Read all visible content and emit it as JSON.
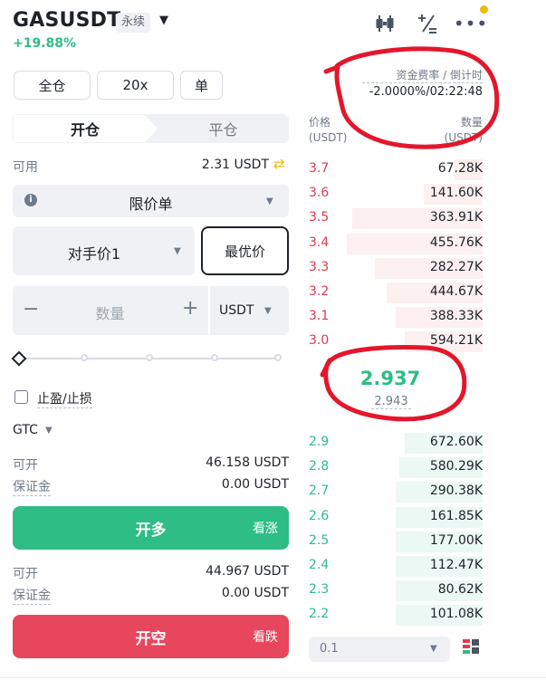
{
  "header": {
    "symbol": "GASUSDT",
    "contract_type": "永续",
    "change": "+19.88%",
    "icons": [
      "candlestick-chart-icon",
      "calculator-icon",
      "more-icon"
    ]
  },
  "controls": {
    "margin_mode": "全仓",
    "leverage": "20x",
    "position_mode": "单"
  },
  "tabs": {
    "open": "开仓",
    "close": "平仓"
  },
  "available": {
    "label": "可用",
    "value": "2.31 USDT"
  },
  "order_type": {
    "value": "限价单"
  },
  "price": {
    "value": "对手价1",
    "best_label": "最优价"
  },
  "quantity": {
    "placeholder": "数量",
    "unit": "USDT",
    "minus": "−",
    "plus": "+"
  },
  "tpsl": {
    "label": "止盈/止损"
  },
  "tif": {
    "value": "GTC"
  },
  "long": {
    "can_open_label": "可开",
    "can_open_value": "46.158 USDT",
    "margin_label": "保证金",
    "margin_value": "0.00 USDT",
    "button": "开多",
    "hint": "看涨"
  },
  "short": {
    "can_open_label": "可开",
    "can_open_value": "44.967 USDT",
    "margin_label": "保证金",
    "margin_value": "0.00 USDT",
    "button": "开空",
    "hint": "看跌"
  },
  "funding": {
    "label": "资金费率 / 倒计时",
    "value": "-2.0000%/02:22:48"
  },
  "orderbook": {
    "price_header": [
      "价格",
      "(USDT)"
    ],
    "qty_header": [
      "数量",
      "(USDT)"
    ],
    "asks": [
      {
        "price": "3.7",
        "qty": "67.28K",
        "depth": 0.16
      },
      {
        "price": "3.6",
        "qty": "141.60K",
        "depth": 0.34
      },
      {
        "price": "3.5",
        "qty": "363.91K",
        "depth": 0.75
      },
      {
        "price": "3.4",
        "qty": "455.76K",
        "depth": 0.78
      },
      {
        "price": "3.3",
        "qty": "282.27K",
        "depth": 0.62
      },
      {
        "price": "3.2",
        "qty": "444.67K",
        "depth": 0.55
      },
      {
        "price": "3.1",
        "qty": "388.33K",
        "depth": 0.5
      },
      {
        "price": "3.0",
        "qty": "594.21K",
        "depth": 0.45
      }
    ],
    "mid_price": "2.937",
    "mark_price": "2.943",
    "bids": [
      {
        "price": "2.9",
        "qty": "672.60K",
        "depth": 0.45
      },
      {
        "price": "2.8",
        "qty": "580.29K",
        "depth": 0.48
      },
      {
        "price": "2.7",
        "qty": "290.38K",
        "depth": 0.5
      },
      {
        "price": "2.6",
        "qty": "161.85K",
        "depth": 0.5
      },
      {
        "price": "2.5",
        "qty": "177.00K",
        "depth": 0.5
      },
      {
        "price": "2.4",
        "qty": "112.47K",
        "depth": 0.5
      },
      {
        "price": "2.3",
        "qty": "80.62K",
        "depth": 0.5
      },
      {
        "price": "2.2",
        "qty": "101.08K",
        "depth": 0.5
      }
    ],
    "precision": "0.1"
  },
  "colors": {
    "buy": "#2ebd85",
    "sell": "#e8465d",
    "annotation": "#e3172c"
  }
}
